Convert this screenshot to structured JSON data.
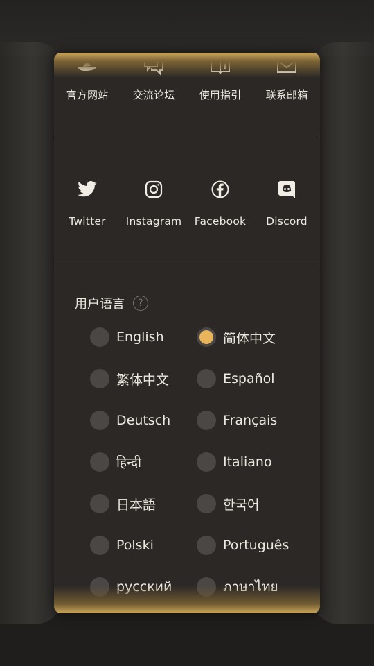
{
  "top_links": [
    {
      "name": "official-site",
      "label": "官方网站",
      "icon": "ship-icon"
    },
    {
      "name": "forum",
      "label": "交流论坛",
      "icon": "chat-icon"
    },
    {
      "name": "guide",
      "label": "使用指引",
      "icon": "book-icon"
    },
    {
      "name": "email",
      "label": "联系邮箱",
      "icon": "mail-icon"
    }
  ],
  "social_links": [
    {
      "name": "twitter",
      "label": "Twitter",
      "icon": "twitter-icon"
    },
    {
      "name": "instagram",
      "label": "Instagram",
      "icon": "instagram-icon"
    },
    {
      "name": "facebook",
      "label": "Facebook",
      "icon": "facebook-icon"
    },
    {
      "name": "discord",
      "label": "Discord",
      "icon": "discord-icon"
    }
  ],
  "language": {
    "title": "用户语言",
    "help": "?",
    "selected": "简体中文",
    "options": [
      "English",
      "简体中文",
      "繁体中文",
      "Español",
      "Deutsch",
      "Français",
      "हिन्दी",
      "Italiano",
      "日本語",
      "한국어",
      "Polski",
      "Português",
      "русский",
      "ภาษาไทย"
    ]
  },
  "colors": {
    "accent": "#e8b55a",
    "panel": "#2b2826",
    "gold": "#c7a45a"
  }
}
